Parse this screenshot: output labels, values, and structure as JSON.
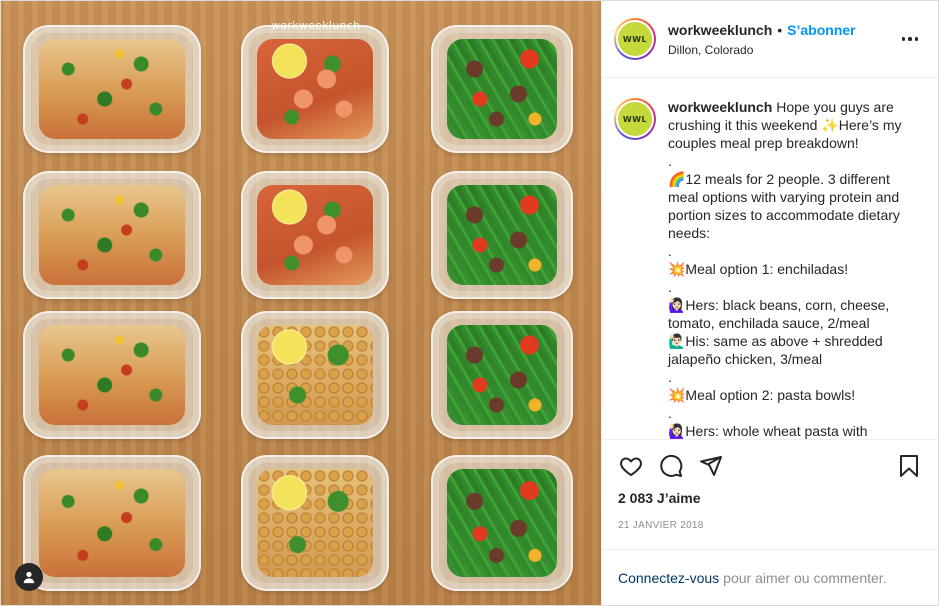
{
  "photo": {
    "watermark": "workweeklunch",
    "containers": [
      {
        "kind": "enchilada"
      },
      {
        "kind": "shrimp"
      },
      {
        "kind": "veggie"
      },
      {
        "kind": "enchilada"
      },
      {
        "kind": "shrimp"
      },
      {
        "kind": "veggie"
      },
      {
        "kind": "enchilada"
      },
      {
        "kind": "chickpea"
      },
      {
        "kind": "veggie"
      },
      {
        "kind": "enchilada"
      },
      {
        "kind": "chickpea"
      },
      {
        "kind": "veggie"
      }
    ]
  },
  "header": {
    "avatar_text": "WWL",
    "username": "workweeklunch",
    "separator": "•",
    "follow_label": "S’abonner",
    "location": "Dillon, Colorado",
    "more_icon": "more-horizontal-icon"
  },
  "caption": {
    "username": "workweeklunch",
    "text": "Hope you guys are crushing it this weekend ✨Here’s my couples meal prep breakdown!\n.\n🌈12 meals for 2 people. 3 different meal options with varying protein and portion sizes to accommodate dietary needs:\n.\n💥Meal option 1: enchiladas!\n.\n🙋🏻‍♀️Hers: black beans, corn, cheese, tomato, enchilada sauce, 2/meal\n🙋🏻‍♂️His: same as above + shredded jalapeño chicken, 3/meal\n.\n💥Meal option 2: pasta bowls!\n.\n🙋🏻‍♀️Hers: whole wheat pasta with spinach, mushroom, red sauce"
  },
  "actions": {
    "like_icon": "heart-icon",
    "comment_icon": "comment-icon",
    "share_icon": "share-icon",
    "save_icon": "bookmark-icon",
    "likes": "2 083 J’aime",
    "date": "21 janvier 2018"
  },
  "login": {
    "link_label": "Connectez-vous",
    "suffix": "pour aimer ou commenter."
  },
  "colors": {
    "accent": "#0095f6",
    "link": "#00376b",
    "muted": "#8e8e8e"
  }
}
